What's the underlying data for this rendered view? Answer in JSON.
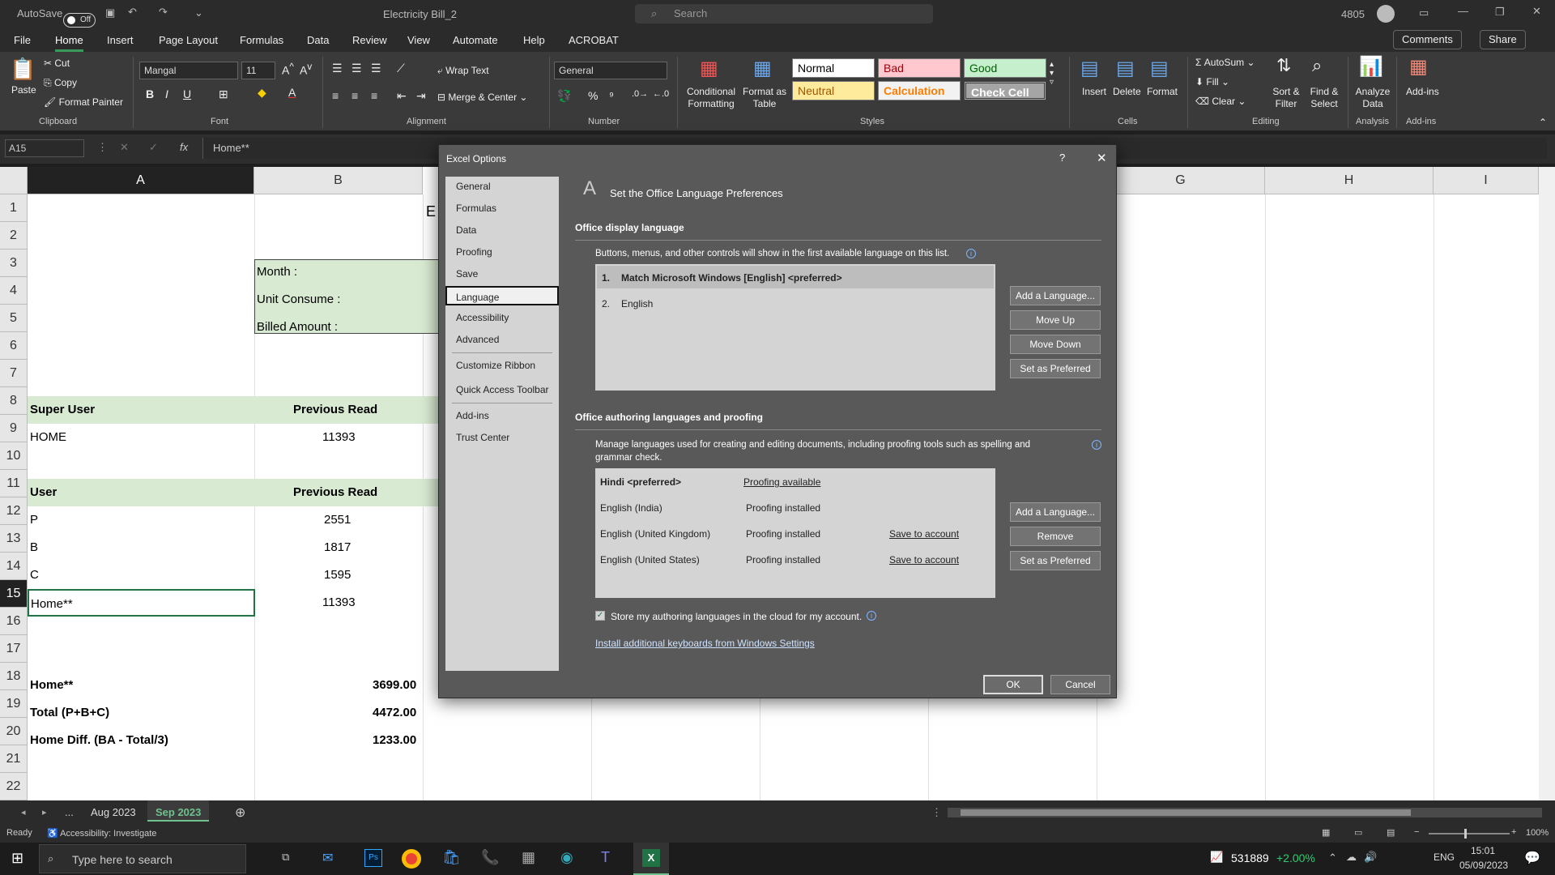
{
  "titlebar": {
    "autosave": "AutoSave",
    "autosave_state": "Off",
    "doc_title": "Electricity Bill_2",
    "search_placeholder": "Search",
    "user_id": "4805"
  },
  "menu": [
    "File",
    "Home",
    "Insert",
    "Page Layout",
    "Formulas",
    "Data",
    "Review",
    "View",
    "Automate",
    "Help",
    "ACROBAT"
  ],
  "menu_right": {
    "comments": "Comments",
    "share": "Share"
  },
  "ribbon": {
    "clipboard": {
      "paste": "Paste",
      "cut": "Cut",
      "copy": "Copy",
      "format_painter": "Format Painter",
      "label": "Clipboard"
    },
    "font": {
      "name": "Mangal",
      "size": "11",
      "label": "Font"
    },
    "alignment": {
      "wrap": "Wrap Text",
      "merge": "Merge & Center",
      "label": "Alignment"
    },
    "number": {
      "format": "General",
      "label": "Number"
    },
    "styles": {
      "cond": "Conditional Formatting",
      "table": "Format as Table",
      "normal": "Normal",
      "bad": "Bad",
      "good": "Good",
      "neutral": "Neutral",
      "calculation": "Calculation",
      "check": "Check Cell",
      "label": "Styles"
    },
    "cells": {
      "insert": "Insert",
      "delete": "Delete",
      "format": "Format",
      "label": "Cells"
    },
    "editing": {
      "autosum": "AutoSum",
      "fill": "Fill",
      "clear": "Clear",
      "sort": "Sort & Filter",
      "find": "Find & Select",
      "label": "Editing"
    },
    "analysis": {
      "analyze": "Analyze Data",
      "label": "Analysis"
    },
    "addins": {
      "addins": "Add-ins",
      "label": "Add-ins"
    }
  },
  "formula_bar": {
    "namebox": "A15",
    "content": "Home**",
    "fx": "fx"
  },
  "sheet": {
    "cols": [
      "A",
      "B",
      "G",
      "H",
      "I"
    ],
    "rows": [
      "1",
      "2",
      "3",
      "4",
      "5",
      "6",
      "7",
      "8",
      "9",
      "10",
      "11",
      "12",
      "13",
      "14",
      "15",
      "16",
      "17",
      "18",
      "19",
      "20",
      "21",
      "22"
    ],
    "b1_partial": "E",
    "cells": {
      "b3": "Month :",
      "b4": "Unit Consume :",
      "b5": "Billed Amount :",
      "a8": "Super User",
      "b8": "Previous Read",
      "a9": "HOME",
      "b9": "11393",
      "a11": "User",
      "b11": "Previous Read",
      "a12": "P",
      "b12": "2551",
      "a13": "B",
      "b13": "1817",
      "a14": "C",
      "b14": "1595",
      "a15": "Home**",
      "b15": "11393",
      "a18": "Home**",
      "b18": "3699.00",
      "a19": "Total (P+B+C)",
      "b19": "4472.00",
      "a20": "Home Diff. (BA - Total/3)",
      "b20": "1233.00"
    }
  },
  "sheet_tabs": {
    "more": "...",
    "tab1": "Aug 2023",
    "tab2": "Sep 2023"
  },
  "status": {
    "ready": "Ready",
    "accessibility": "Accessibility: Investigate",
    "zoom": "100%"
  },
  "taskbar": {
    "search": "Type here to search",
    "stock": "531889",
    "change": "+2.00%",
    "lang": "ENG",
    "time": "15:01",
    "date": "05/09/2023"
  },
  "dialog": {
    "title": "Excel Options",
    "help": "?",
    "nav": [
      "General",
      "Formulas",
      "Data",
      "Proofing",
      "Save",
      "Language",
      "Accessibility",
      "Advanced",
      "Customize Ribbon",
      "Quick Access Toolbar",
      "Add-ins",
      "Trust Center"
    ],
    "heading": "Set the Office Language Preferences",
    "display_section": "Office display language",
    "display_desc": "Buttons, menus, and other controls will show in the first available language on this list.",
    "display_list": [
      {
        "num": "1.",
        "name": "Match Microsoft Windows [English] <preferred>"
      },
      {
        "num": "2.",
        "name": "English"
      }
    ],
    "display_buttons": [
      "Add a Language...",
      "Move Up",
      "Move Down",
      "Set as Preferred"
    ],
    "authoring_section": "Office authoring languages and proofing",
    "authoring_desc1": "Manage languages used for creating and editing documents, including proofing tools such as spelling and",
    "authoring_desc2": "grammar check.",
    "authoring_list": [
      {
        "lang": "Hindi <preferred>",
        "status": "Proofing available",
        "action": ""
      },
      {
        "lang": "English (India)",
        "status": "Proofing installed",
        "action": ""
      },
      {
        "lang": "English (United Kingdom)",
        "status": "Proofing installed",
        "action": "Save to account"
      },
      {
        "lang": "English (United States)",
        "status": "Proofing installed",
        "action": "Save to account"
      }
    ],
    "authoring_buttons": [
      "Add a Language...",
      "Remove",
      "Set as Preferred"
    ],
    "store_checkbox": "Store my authoring languages in the cloud for my account.",
    "install_link": "Install additional keyboards from Windows Settings",
    "ok": "OK",
    "cancel": "Cancel"
  }
}
